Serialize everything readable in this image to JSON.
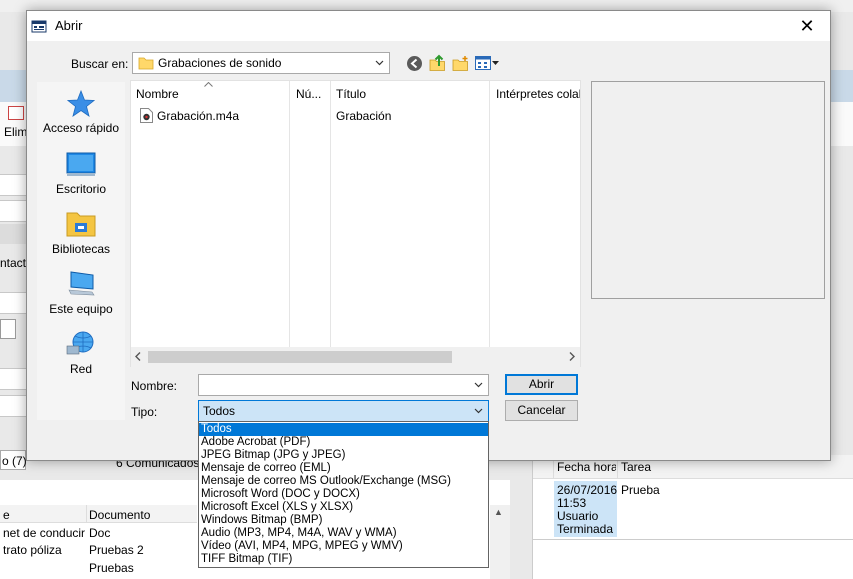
{
  "dialog": {
    "title": "Abrir",
    "look_in_label": "Buscar en:",
    "look_in_value": "Grabaciones de sonido",
    "name_label": "Nombre:",
    "name_value": "",
    "type_label": "Tipo:",
    "type_value": "Todos",
    "open_button": "Abrir",
    "cancel_button": "Cancelar"
  },
  "places": [
    {
      "label": "Acceso rápido",
      "icon": "star-icon"
    },
    {
      "label": "Escritorio",
      "icon": "desktop-icon"
    },
    {
      "label": "Bibliotecas",
      "icon": "libraries-icon"
    },
    {
      "label": "Este equipo",
      "icon": "computer-icon"
    },
    {
      "label": "Red",
      "icon": "network-icon"
    }
  ],
  "file_list": {
    "columns": [
      "Nombre",
      "Nú...",
      "Título",
      "Intérpretes colab"
    ],
    "files": [
      {
        "name": "Grabación.m4a",
        "number": "",
        "title": "Grabación",
        "artists": ""
      }
    ]
  },
  "type_options": [
    "Todos",
    "Adobe Acrobat (PDF)",
    "JPEG Bitmap (JPG y JPEG)",
    "Mensaje de correo (EML)",
    "Mensaje de correo MS Outlook/Exchange (MSG)",
    "Microsoft Word (DOC y DOCX)",
    "Microsoft Excel (XLS y XLSX)",
    "Windows Bitmap (BMP)",
    "Audio (MP3, MP4, M4A, WAV y WMA)",
    "Vídeo (AVI, MP4, MPG, MPEG y WMV)",
    "TIFF Bitmap (TIF)"
  ],
  "background": {
    "toolbar_label": "Elimi",
    "side_label": "ntacto",
    "tabs": [
      "o (7)",
      "6 Comunicados (9"
    ],
    "left_grid": {
      "columns": [
        "e",
        "Documento"
      ],
      "rows": [
        [
          "net de conducir",
          "Doc"
        ],
        [
          "trato póliza",
          "Pruebas 2"
        ],
        [
          "",
          "Pruebas"
        ]
      ]
    },
    "right_grid": {
      "columns": [
        "Fecha hora",
        "Tarea"
      ],
      "rows": [
        {
          "date": "26/07/2016",
          "time": "11:53",
          "user": "Usuario",
          "status": "Terminada",
          "task": "Prueba"
        }
      ]
    }
  },
  "colors": {
    "accent": "#0078d7",
    "selection_bg": "#cce4f7"
  }
}
